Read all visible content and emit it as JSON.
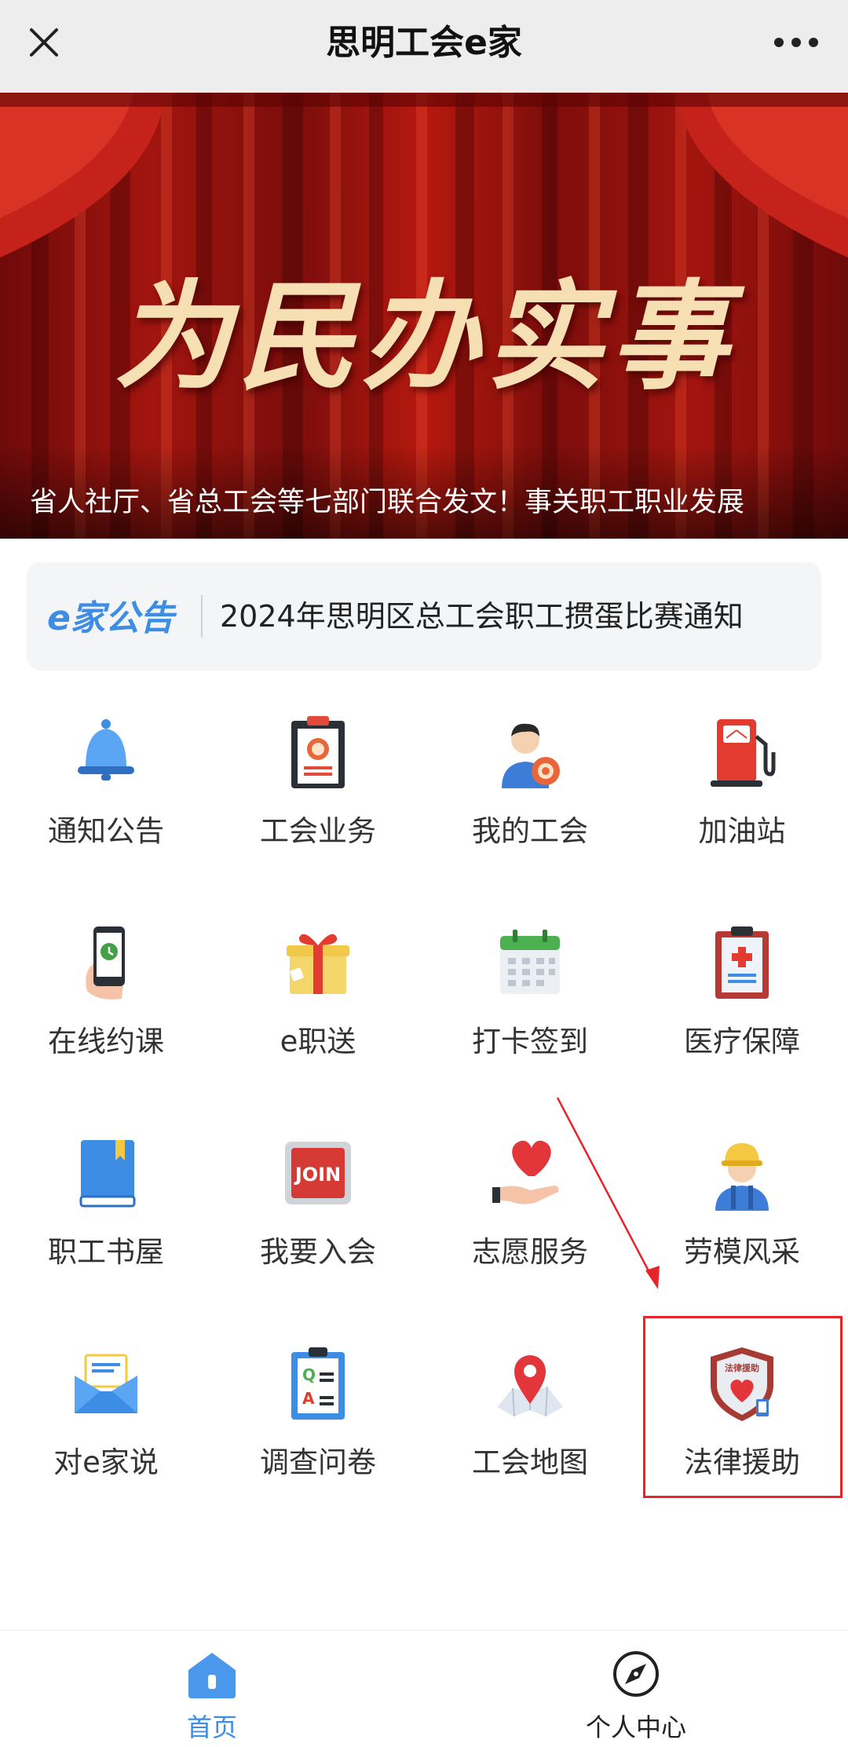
{
  "topbar": {
    "title": "思明工会e家",
    "close_icon": "close-icon",
    "more_icon": "more-dots-icon"
  },
  "banner": {
    "calligraphy": "为民办实事",
    "caption": "省人社厅、省总工会等七部门联合发文！事关职工职业发展"
  },
  "notice": {
    "brand": "e家公告",
    "text": "2024年思明区总工会职工掼蛋比赛通知"
  },
  "grid": {
    "rows": [
      [
        {
          "label": "通知公告",
          "icon": "bell-icon"
        },
        {
          "label": "工会业务",
          "icon": "clipboard-badge-icon"
        },
        {
          "label": "我的工会",
          "icon": "member-avatar-icon"
        },
        {
          "label": "加油站",
          "icon": "gas-pump-icon"
        }
      ],
      [
        {
          "label": "在线约课",
          "icon": "phone-clock-icon"
        },
        {
          "label": "e职送",
          "icon": "gift-icon"
        },
        {
          "label": "打卡签到",
          "icon": "calendar-icon"
        },
        {
          "label": "医疗保障",
          "icon": "medical-clipboard-icon"
        }
      ],
      [
        {
          "label": "职工书屋",
          "icon": "book-icon"
        },
        {
          "label": "我要入会",
          "icon": "join-sign-icon"
        },
        {
          "label": "志愿服务",
          "icon": "heart-hand-icon"
        },
        {
          "label": "劳模风采",
          "icon": "worker-helmet-icon"
        }
      ],
      [
        {
          "label": "对e家说",
          "icon": "envelope-icon"
        },
        {
          "label": "调查问卷",
          "icon": "qa-clipboard-icon"
        },
        {
          "label": "工会地图",
          "icon": "map-pin-icon"
        },
        {
          "label": "法律援助",
          "icon": "legal-shield-icon",
          "badge": "法律援助"
        }
      ]
    ],
    "join_text": "JOIN",
    "qa_q": "Q",
    "qa_a": "A"
  },
  "nav": {
    "home": "首页",
    "profile": "个人中心",
    "active_color": "#3d8de5",
    "inactive_color": "#222222"
  },
  "colors": {
    "highlight": "#e8232a",
    "brand_blue": "#3d8de5"
  }
}
